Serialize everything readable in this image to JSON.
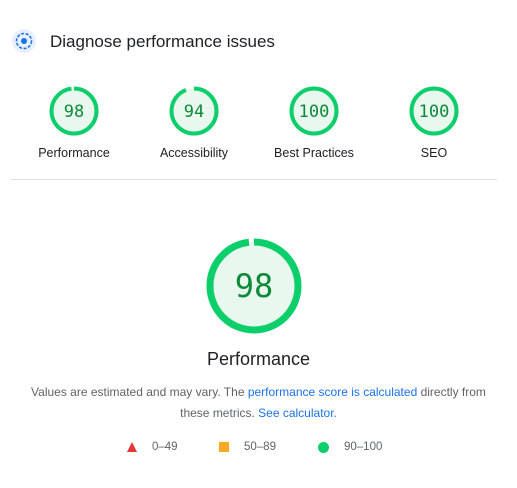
{
  "header": {
    "title": "Diagnose performance issues",
    "icon": "lighthouse-icon"
  },
  "categories": [
    {
      "label": "Performance",
      "score": "98",
      "fraction": 0.98
    },
    {
      "label": "Accessibility",
      "score": "94",
      "fraction": 0.94
    },
    {
      "label": "Best Practices",
      "score": "100",
      "fraction": 1.0
    },
    {
      "label": "SEO",
      "score": "100",
      "fraction": 1.0
    }
  ],
  "main": {
    "score": "98",
    "fraction": 0.98,
    "title": "Performance",
    "desc_prefix": "Values are estimated and may vary. The ",
    "desc_link": "performance score is calculated",
    "desc_mid": " directly from these metrics. ",
    "calc_link": "See calculator."
  },
  "legend": [
    {
      "range": "0–49",
      "shape": "triangle",
      "color": "#e53935"
    },
    {
      "range": "50–89",
      "shape": "square",
      "color": "#f9a825"
    },
    {
      "range": "90–100",
      "shape": "circle",
      "color": "#0cce6b"
    }
  ],
  "colors": {
    "pass": "#0cce6b",
    "pass_text": "#0c8a37",
    "pass_fill": "#e8f8ee",
    "link": "#1a73e8"
  }
}
